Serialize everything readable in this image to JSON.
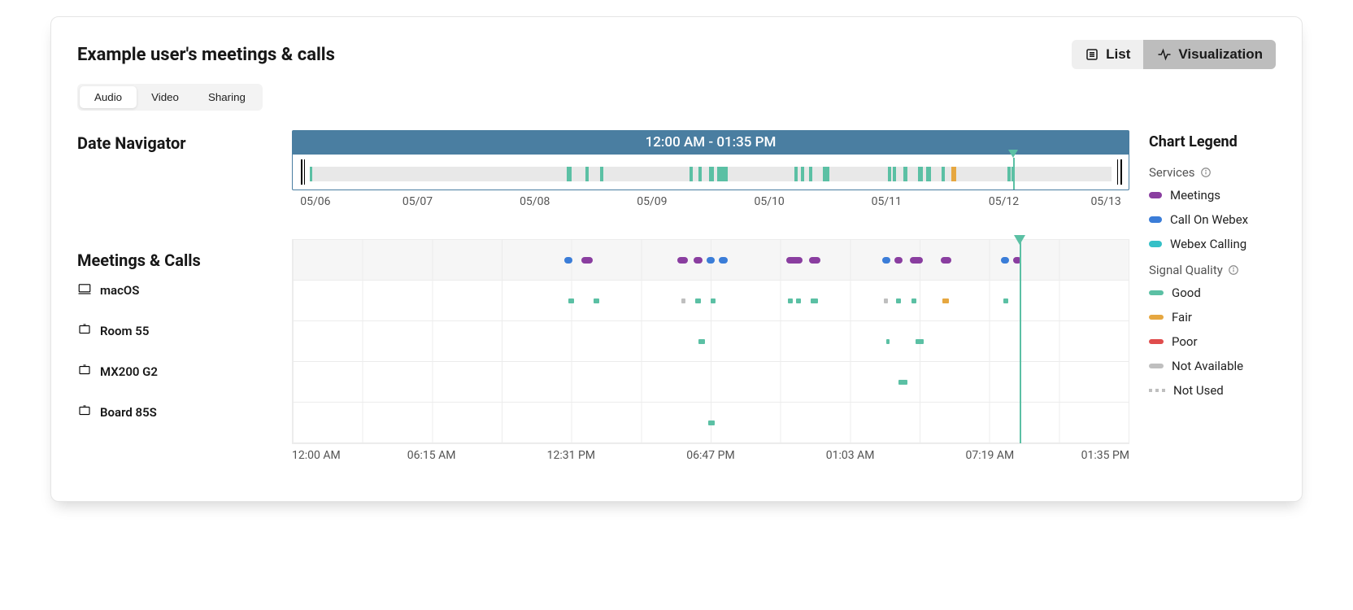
{
  "title": "Example user's meetings & calls",
  "view_toggle": {
    "list": "List",
    "visualization": "Visualization",
    "active": "visualization"
  },
  "media_tabs": {
    "audio": "Audio",
    "video": "Video",
    "sharing": "Sharing",
    "active": "audio"
  },
  "date_navigator": {
    "label": "Date Navigator",
    "range_label": "12:00 AM - 01:35 PM",
    "dates": [
      "05/06",
      "05/07",
      "05/08",
      "05/09",
      "05/10",
      "05/11",
      "05/12",
      "05/13"
    ],
    "playhead_percent": 86.2
  },
  "meetings_calls": {
    "label": "Meetings & Calls",
    "rows": [
      "macOS",
      "Room 55",
      "MX200 G2",
      "Board 85S"
    ],
    "time_labels": [
      "12:00 AM",
      "06:15 AM",
      "12:31 PM",
      "06:47 PM",
      "01:03 AM",
      "07:19 AM",
      "01:35 PM"
    ],
    "playhead_percent": 87.0
  },
  "legend": {
    "title": "Chart Legend",
    "services_label": "Services",
    "services": {
      "meetings": "Meetings",
      "call_on_webex": "Call On Webex",
      "webex_calling": "Webex Calling"
    },
    "signal_label": "Signal Quality",
    "signal": {
      "good": "Good",
      "fair": "Fair",
      "poor": "Poor",
      "not_available": "Not Available",
      "not_used": "Not Used"
    }
  },
  "colors": {
    "meetings": "#8a3ea0",
    "call_on_webex": "#3b7dd8",
    "webex_calling": "#35c0c7",
    "good": "#5bc0a4",
    "fair": "#e6a740",
    "poor": "#e04c4c",
    "not_available": "#bfbfbf"
  },
  "chart_data": {
    "type": "timeline",
    "date_navigator": {
      "start_date": "05/06",
      "end_date": "05/13",
      "events": [
        {
          "pos": 2.0,
          "w": 0.3,
          "quality": "good"
        },
        {
          "pos": 32.8,
          "w": 0.6,
          "quality": "good"
        },
        {
          "pos": 35.0,
          "w": 0.4,
          "quality": "good"
        },
        {
          "pos": 36.8,
          "w": 0.4,
          "quality": "good"
        },
        {
          "pos": 47.5,
          "w": 0.4,
          "quality": "good"
        },
        {
          "pos": 48.5,
          "w": 0.4,
          "quality": "good"
        },
        {
          "pos": 49.8,
          "w": 0.6,
          "quality": "good"
        },
        {
          "pos": 50.8,
          "w": 1.2,
          "quality": "good"
        },
        {
          "pos": 60.0,
          "w": 0.4,
          "quality": "good"
        },
        {
          "pos": 60.8,
          "w": 0.4,
          "quality": "good"
        },
        {
          "pos": 61.8,
          "w": 0.4,
          "quality": "good"
        },
        {
          "pos": 63.4,
          "w": 0.8,
          "quality": "good"
        },
        {
          "pos": 71.2,
          "w": 0.4,
          "quality": "good"
        },
        {
          "pos": 71.8,
          "w": 0.4,
          "quality": "good"
        },
        {
          "pos": 73.1,
          "w": 0.4,
          "quality": "good"
        },
        {
          "pos": 74.8,
          "w": 0.6,
          "quality": "good"
        },
        {
          "pos": 75.8,
          "w": 0.6,
          "quality": "good"
        },
        {
          "pos": 77.6,
          "w": 0.4,
          "quality": "good"
        },
        {
          "pos": 78.8,
          "w": 0.6,
          "quality": "fair"
        },
        {
          "pos": 85.5,
          "w": 0.4,
          "quality": "good"
        },
        {
          "pos": 86.0,
          "w": 0.4,
          "quality": "good"
        }
      ]
    },
    "timeline": {
      "start_label": "12:00 AM",
      "end_label": "01:35 PM",
      "header_events": [
        {
          "pos": 32.5,
          "w": 1.0,
          "service": "call_on_webex"
        },
        {
          "pos": 34.5,
          "w": 1.4,
          "service": "meetings"
        },
        {
          "pos": 46.0,
          "w": 1.3,
          "service": "meetings"
        },
        {
          "pos": 48.0,
          "w": 1.0,
          "service": "meetings"
        },
        {
          "pos": 49.5,
          "w": 1.0,
          "service": "call_on_webex"
        },
        {
          "pos": 51.0,
          "w": 1.0,
          "service": "call_on_webex"
        },
        {
          "pos": 59.0,
          "w": 2.0,
          "service": "meetings"
        },
        {
          "pos": 61.8,
          "w": 1.3,
          "service": "meetings"
        },
        {
          "pos": 70.5,
          "w": 1.0,
          "service": "call_on_webex"
        },
        {
          "pos": 72.0,
          "w": 1.0,
          "service": "meetings"
        },
        {
          "pos": 73.8,
          "w": 1.6,
          "service": "meetings"
        },
        {
          "pos": 77.5,
          "w": 1.3,
          "service": "meetings"
        },
        {
          "pos": 84.7,
          "w": 1.0,
          "service": "call_on_webex"
        },
        {
          "pos": 86.2,
          "w": 1.0,
          "service": "meetings"
        }
      ],
      "rows": [
        {
          "name": "macOS",
          "events": [
            {
              "pos": 33.0,
              "w": 0.7,
              "quality": "good"
            },
            {
              "pos": 36.0,
              "w": 0.7,
              "quality": "good"
            },
            {
              "pos": 46.5,
              "w": 0.5,
              "quality": "not_available"
            },
            {
              "pos": 48.2,
              "w": 0.6,
              "quality": "good"
            },
            {
              "pos": 50.0,
              "w": 0.6,
              "quality": "good"
            },
            {
              "pos": 59.2,
              "w": 0.6,
              "quality": "good"
            },
            {
              "pos": 60.2,
              "w": 0.6,
              "quality": "good"
            },
            {
              "pos": 62.0,
              "w": 0.8,
              "quality": "good"
            },
            {
              "pos": 70.7,
              "w": 0.5,
              "quality": "not_available"
            },
            {
              "pos": 72.2,
              "w": 0.6,
              "quality": "good"
            },
            {
              "pos": 74.0,
              "w": 0.6,
              "quality": "good"
            },
            {
              "pos": 77.7,
              "w": 0.8,
              "quality": "fair"
            },
            {
              "pos": 85.0,
              "w": 0.6,
              "quality": "good"
            }
          ]
        },
        {
          "name": "Room 55",
          "events": [
            {
              "pos": 48.5,
              "w": 0.8,
              "quality": "good"
            },
            {
              "pos": 71.0,
              "w": 0.4,
              "quality": "good"
            },
            {
              "pos": 74.5,
              "w": 1.0,
              "quality": "good"
            }
          ]
        },
        {
          "name": "MX200 G2",
          "events": [
            {
              "pos": 72.5,
              "w": 1.0,
              "quality": "good"
            }
          ]
        },
        {
          "name": "Board 85S",
          "events": [
            {
              "pos": 49.7,
              "w": 0.8,
              "quality": "good"
            }
          ]
        }
      ]
    }
  }
}
